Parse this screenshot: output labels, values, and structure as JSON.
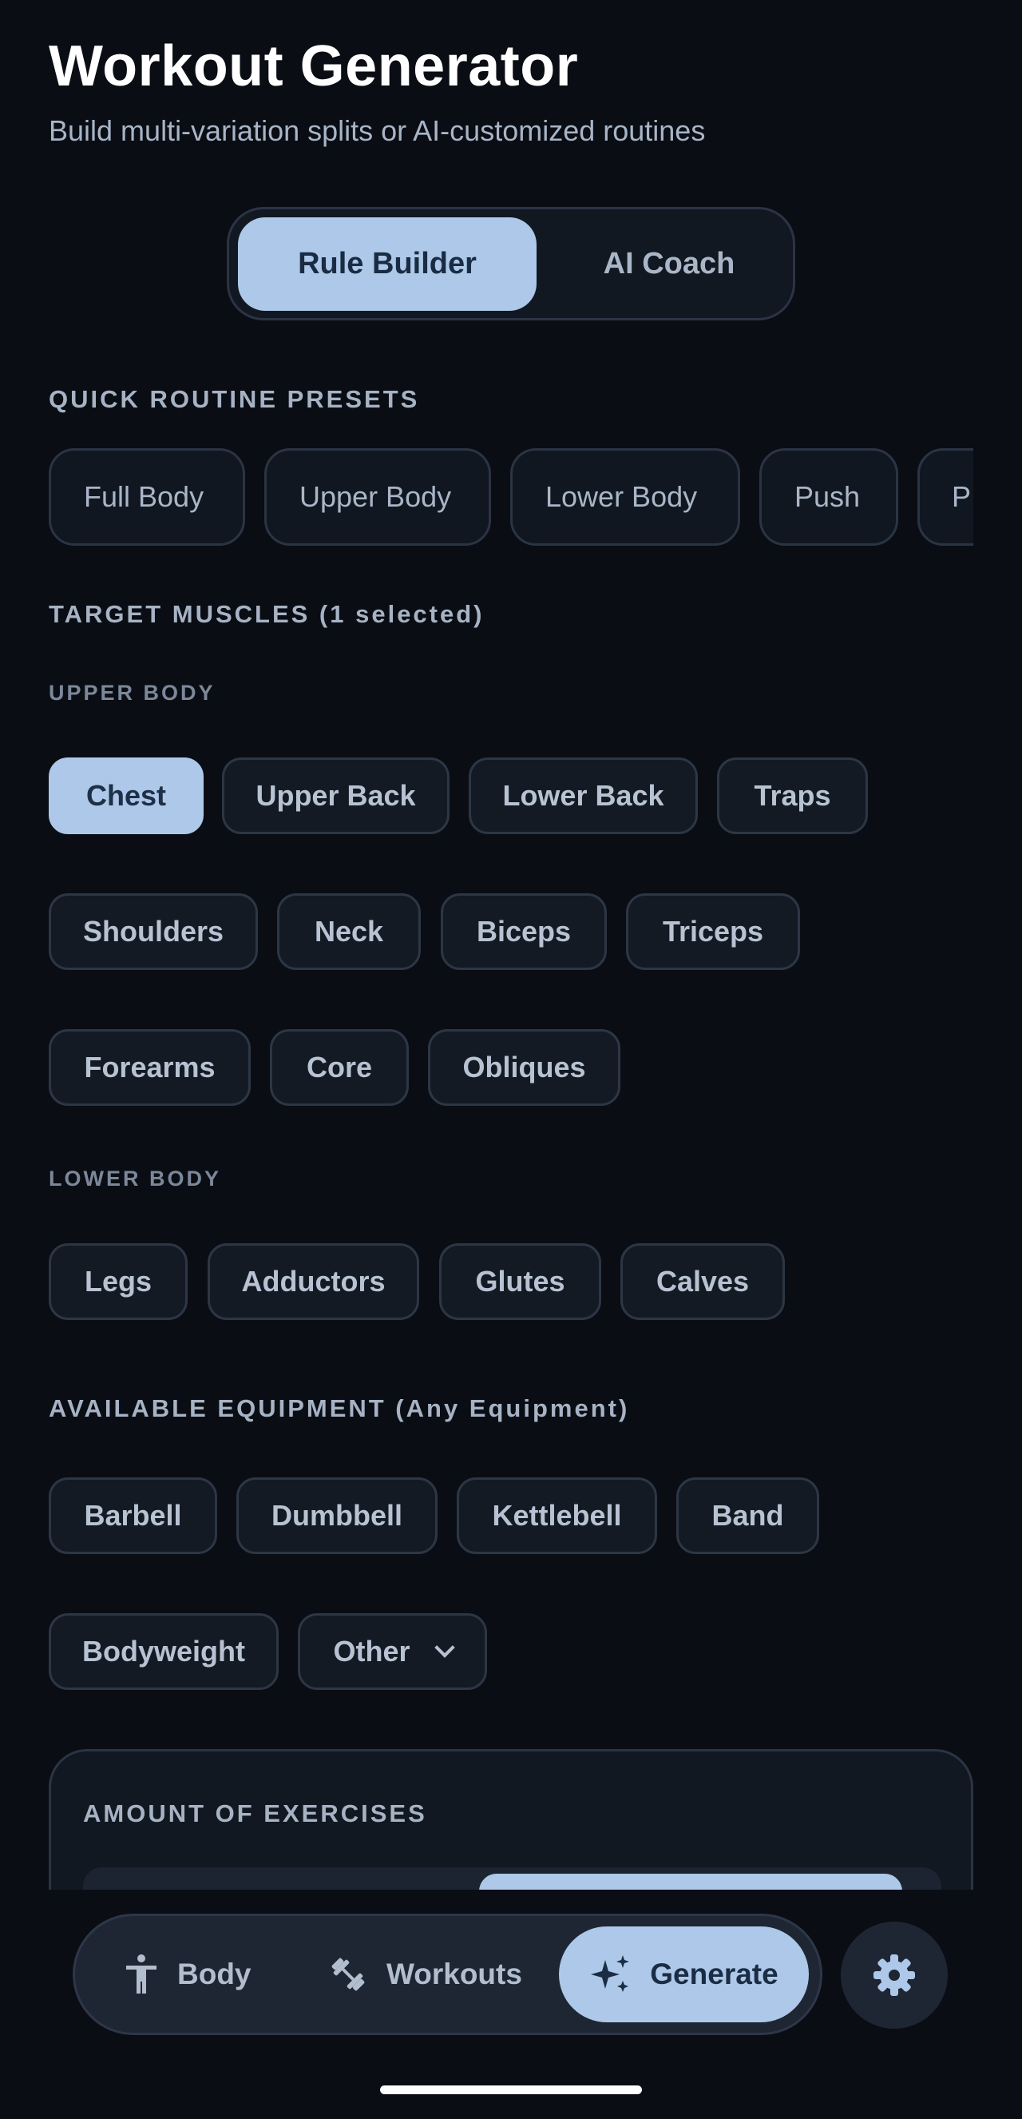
{
  "header": {
    "title": "Workout Generator",
    "subtitle": "Build multi-variation splits or AI-customized routines"
  },
  "mode_toggle": {
    "options": [
      "Rule Builder",
      "AI Coach"
    ],
    "selected": "Rule Builder"
  },
  "presets": {
    "heading": "QUICK ROUTINE PRESETS",
    "items": [
      "Full Body",
      "Upper Body",
      "Lower Body",
      "Push",
      "P"
    ]
  },
  "muscles": {
    "heading": "TARGET MUSCLES (1 selected)",
    "upper": {
      "label": "UPPER BODY",
      "items": [
        "Chest",
        "Upper Back",
        "Lower Back",
        "Traps",
        "Shoulders",
        "Neck",
        "Biceps",
        "Triceps",
        "Forearms",
        "Core",
        "Obliques"
      ],
      "selected": [
        "Chest"
      ]
    },
    "lower": {
      "label": "LOWER BODY",
      "items": [
        "Legs",
        "Adductors",
        "Glutes",
        "Calves"
      ]
    }
  },
  "equipment": {
    "heading": "AVAILABLE EQUIPMENT (Any Equipment)",
    "items": [
      "Barbell",
      "Dumbbell",
      "Kettlebell",
      "Band",
      "Bodyweight"
    ],
    "dropdown_label": "Other"
  },
  "exercise_amount": {
    "heading": "AMOUNT OF EXERCISES"
  },
  "bottom_nav": {
    "items": [
      {
        "label": "Body",
        "icon": "person-icon"
      },
      {
        "label": "Workouts",
        "icon": "dumbbell-icon"
      },
      {
        "label": "Generate",
        "icon": "sparkle-icon"
      }
    ],
    "active": "Generate",
    "settings_icon": "gear-icon"
  },
  "colors": {
    "background": "#0a0d14",
    "accent": "#adc8e8",
    "chip_bg": "#141a23",
    "border": "#2d3645"
  }
}
